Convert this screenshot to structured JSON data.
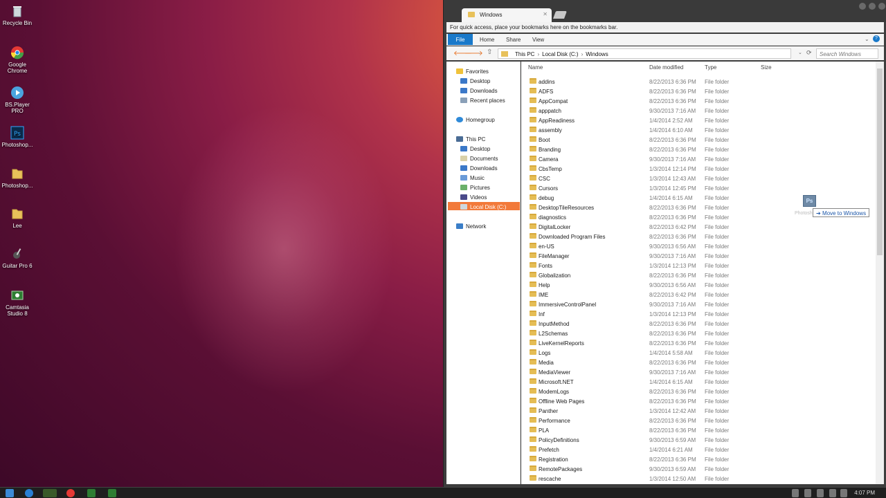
{
  "desktop": {
    "icons": [
      {
        "label": "Recycle Bin",
        "icon": "recycle-bin-icon"
      },
      {
        "label": "Google Chrome",
        "icon": "chrome-icon"
      },
      {
        "label": "BS.Player PRO",
        "icon": "bsplayer-icon"
      },
      {
        "label": "Photoshop...",
        "icon": "photoshop-icon"
      },
      {
        "label": "Photoshop...",
        "icon": "folder-icon"
      },
      {
        "label": "Lee",
        "icon": "folder-icon"
      },
      {
        "label": "Guitar Pro 6",
        "icon": "guitar-pro-icon"
      },
      {
        "label": "Camtasia Studio 8",
        "icon": "camtasia-icon"
      }
    ]
  },
  "window": {
    "tab_title": "Windows",
    "bookmarks_hint": "For quick access, place your bookmarks here on the bookmarks bar.",
    "ribbon": {
      "file": "File",
      "home": "Home",
      "share": "Share",
      "view": "View"
    },
    "address": {
      "part1": "This PC",
      "part2": "Local Disk (C:)",
      "part3": "Windows"
    },
    "search_placeholder": "Search Windows",
    "columns": {
      "name": "Name",
      "date": "Date modified",
      "type": "Type",
      "size": "Size"
    }
  },
  "nav": {
    "favorites": "Favorites",
    "fav_items": [
      "Desktop",
      "Downloads",
      "Recent places"
    ],
    "homegroup": "Homegroup",
    "this_pc": "This PC",
    "pc_items": [
      "Desktop",
      "Documents",
      "Downloads",
      "Music",
      "Pictures",
      "Videos",
      "Local Disk (C:)"
    ],
    "network": "Network"
  },
  "files": [
    {
      "name": "addins",
      "date": "8/22/2013 6:36 PM",
      "type": "File folder"
    },
    {
      "name": "ADFS",
      "date": "8/22/2013 6:36 PM",
      "type": "File folder"
    },
    {
      "name": "AppCompat",
      "date": "8/22/2013 6:36 PM",
      "type": "File folder"
    },
    {
      "name": "apppatch",
      "date": "9/30/2013 7:16 AM",
      "type": "File folder"
    },
    {
      "name": "AppReadiness",
      "date": "1/4/2014 2:52 AM",
      "type": "File folder"
    },
    {
      "name": "assembly",
      "date": "1/4/2014 6:10 AM",
      "type": "File folder"
    },
    {
      "name": "Boot",
      "date": "8/22/2013 6:36 PM",
      "type": "File folder"
    },
    {
      "name": "Branding",
      "date": "8/22/2013 6:36 PM",
      "type": "File folder"
    },
    {
      "name": "Camera",
      "date": "9/30/2013 7:16 AM",
      "type": "File folder"
    },
    {
      "name": "CbsTemp",
      "date": "1/3/2014 12:14 PM",
      "type": "File folder"
    },
    {
      "name": "CSC",
      "date": "1/3/2014 12:43 AM",
      "type": "File folder"
    },
    {
      "name": "Cursors",
      "date": "1/3/2014 12:45 PM",
      "type": "File folder"
    },
    {
      "name": "debug",
      "date": "1/4/2014 6:15 AM",
      "type": "File folder"
    },
    {
      "name": "DesktopTileResources",
      "date": "8/22/2013 6:36 PM",
      "type": "File folder"
    },
    {
      "name": "diagnostics",
      "date": "8/22/2013 6:36 PM",
      "type": "File folder"
    },
    {
      "name": "DigitalLocker",
      "date": "8/22/2013 6:42 PM",
      "type": "File folder"
    },
    {
      "name": "Downloaded Program Files",
      "date": "8/22/2013 6:36 PM",
      "type": "File folder"
    },
    {
      "name": "en-US",
      "date": "9/30/2013 6:56 AM",
      "type": "File folder"
    },
    {
      "name": "FileManager",
      "date": "9/30/2013 7:16 AM",
      "type": "File folder"
    },
    {
      "name": "Fonts",
      "date": "1/3/2014 12:13 PM",
      "type": "File folder"
    },
    {
      "name": "Globalization",
      "date": "8/22/2013 6:36 PM",
      "type": "File folder"
    },
    {
      "name": "Help",
      "date": "9/30/2013 6:56 AM",
      "type": "File folder"
    },
    {
      "name": "IME",
      "date": "8/22/2013 6:42 PM",
      "type": "File folder"
    },
    {
      "name": "ImmersiveControlPanel",
      "date": "9/30/2013 7:16 AM",
      "type": "File folder"
    },
    {
      "name": "Inf",
      "date": "1/3/2014 12:13 PM",
      "type": "File folder"
    },
    {
      "name": "InputMethod",
      "date": "8/22/2013 6:36 PM",
      "type": "File folder"
    },
    {
      "name": "L2Schemas",
      "date": "8/22/2013 6:36 PM",
      "type": "File folder"
    },
    {
      "name": "LiveKernelReports",
      "date": "8/22/2013 6:36 PM",
      "type": "File folder"
    },
    {
      "name": "Logs",
      "date": "1/4/2014 5:58 AM",
      "type": "File folder"
    },
    {
      "name": "Media",
      "date": "8/22/2013 6:36 PM",
      "type": "File folder"
    },
    {
      "name": "MediaViewer",
      "date": "9/30/2013 7:16 AM",
      "type": "File folder"
    },
    {
      "name": "Microsoft.NET",
      "date": "1/4/2014 6:15 AM",
      "type": "File folder"
    },
    {
      "name": "ModemLogs",
      "date": "8/22/2013 6:36 PM",
      "type": "File folder"
    },
    {
      "name": "Offline Web Pages",
      "date": "8/22/2013 6:36 PM",
      "type": "File folder"
    },
    {
      "name": "Panther",
      "date": "1/3/2014 12:42 AM",
      "type": "File folder"
    },
    {
      "name": "Performance",
      "date": "8/22/2013 6:36 PM",
      "type": "File folder"
    },
    {
      "name": "PLA",
      "date": "8/22/2013 6:36 PM",
      "type": "File folder"
    },
    {
      "name": "PolicyDefinitions",
      "date": "9/30/2013 6:59 AM",
      "type": "File folder"
    },
    {
      "name": "Prefetch",
      "date": "1/4/2014 6:21 AM",
      "type": "File folder"
    },
    {
      "name": "Registration",
      "date": "8/22/2013 6:36 PM",
      "type": "File folder"
    },
    {
      "name": "RemotePackages",
      "date": "9/30/2013 6:59 AM",
      "type": "File folder"
    },
    {
      "name": "rescache",
      "date": "1/3/2014 12:50 AM",
      "type": "File folder"
    }
  ],
  "drag": {
    "icon_text": "Ps",
    "tooltip": "Move to Windows",
    "ghost_label": "Photosh..."
  },
  "taskbar": {
    "time": "4:07 PM"
  },
  "colors": {
    "accent": "#1979ca",
    "selection": "#f27a3a",
    "folder": "#e5bd55"
  }
}
